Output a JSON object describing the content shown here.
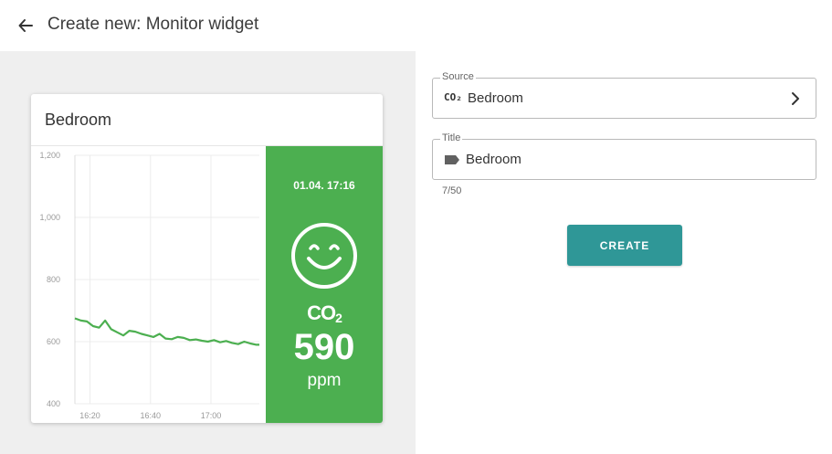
{
  "header": {
    "title": "Create new: Monitor widget",
    "back_icon": "arrow-left-icon"
  },
  "widget": {
    "title": "Bedroom",
    "timestamp": "01.04. 17:16",
    "sensor_label": "CO",
    "sensor_subscript": "2",
    "value": "590",
    "unit": "ppm",
    "status_icon": "smiley-face-icon",
    "panel_color": "#4caf50"
  },
  "chart_data": {
    "type": "line",
    "x": [
      "16:15",
      "16:17",
      "16:19",
      "16:21",
      "16:23",
      "16:25",
      "16:27",
      "16:29",
      "16:31",
      "16:33",
      "16:35",
      "16:37",
      "16:39",
      "16:41",
      "16:43",
      "16:45",
      "16:47",
      "16:49",
      "16:51",
      "16:53",
      "16:55",
      "16:57",
      "16:59",
      "17:01",
      "17:03",
      "17:05",
      "17:07",
      "17:09",
      "17:11",
      "17:13",
      "17:15",
      "17:16"
    ],
    "series": [
      {
        "values": [
          675,
          668,
          665,
          650,
          645,
          668,
          640,
          630,
          620,
          635,
          632,
          625,
          620,
          615,
          625,
          610,
          608,
          615,
          612,
          605,
          607,
          603,
          600,
          605,
          598,
          602,
          596,
          592,
          600,
          594,
          590,
          590
        ]
      }
    ],
    "xticks": [
      "16:20",
      "16:40",
      "17:00"
    ],
    "yticks": [
      "400",
      "600",
      "800",
      "1,000",
      "1,200"
    ],
    "ylim": [
      400,
      1200
    ],
    "grid": true,
    "line_color": "#4caf50"
  },
  "form": {
    "source": {
      "legend": "Source",
      "icon_label": "CO₂",
      "value": "Bedroom",
      "chevron_icon": "chevron-right-icon"
    },
    "title": {
      "legend": "Title",
      "icon": "label-tag-icon",
      "value": "Bedroom"
    },
    "counter": "7/50",
    "create_label": "CREATE",
    "accent": "#2f9797"
  }
}
